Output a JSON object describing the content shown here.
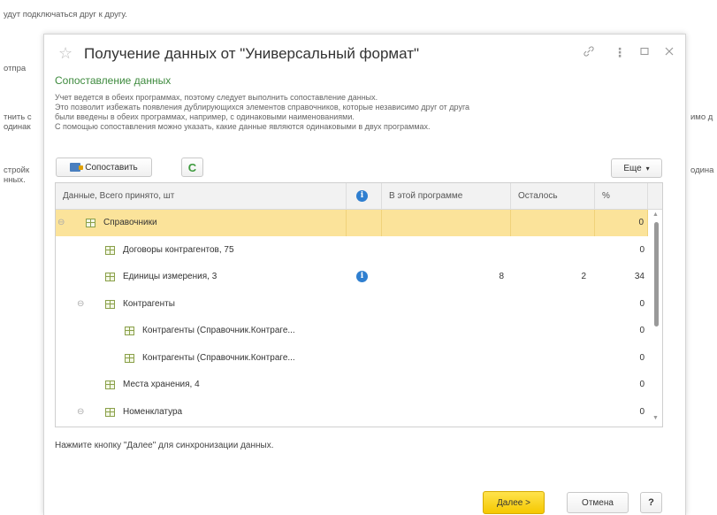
{
  "background": {
    "line1": "удут подключаться друг к другу.",
    "left_fragments": [
      "отпра",
      "тнить с",
      "одинак",
      "стройк",
      "нных."
    ],
    "right_fragments": [
      "имо д",
      "одина"
    ]
  },
  "dialog": {
    "title": "Получение данных от \"Универсальный формат\"",
    "icons": {
      "favorite": "star-icon",
      "link": "link-icon",
      "more": "more-vertical-icon",
      "maximize": "maximize-icon",
      "close": "close-icon"
    },
    "subheading": "Сопоставление данных",
    "description": [
      "Учет ведется в обеих программах, поэтому следует выполнить сопоставление данных.",
      "Это позволит избежать появления дублирующихся элементов справочников, которые независимо друг от друга",
      "были введены в обеих программах, например, с одинаковыми наименованиями.",
      "С помощью сопоставления можно указать, какие данные являются одинаковыми в двух программах."
    ],
    "toolbar": {
      "match_label": "Сопоставить",
      "refresh_icon": "refresh-icon",
      "more_label": "Еще",
      "more_arrow": "▾"
    },
    "table": {
      "columns": {
        "name": "Данные, Всего принято, шт",
        "info": "i",
        "in_program": "В этой программе",
        "remaining": "Осталось",
        "percent": "%"
      },
      "rows": [
        {
          "label": "Справочники",
          "level": 0,
          "group": true,
          "info": false,
          "in_program": "",
          "remaining": "",
          "percent": "0",
          "selected": true
        },
        {
          "label": "Договоры контрагентов, 75",
          "level": 1,
          "group": false,
          "info": false,
          "in_program": "",
          "remaining": "",
          "percent": "0",
          "selected": false
        },
        {
          "label": "Единицы измерения, 3",
          "level": 1,
          "group": false,
          "info": true,
          "in_program": "8",
          "remaining": "2",
          "percent": "34",
          "selected": false
        },
        {
          "label": "Контрагенты",
          "level": 1,
          "group": true,
          "info": false,
          "in_program": "",
          "remaining": "",
          "percent": "0",
          "selected": false
        },
        {
          "label": "Контрагенты (Справочник.Контраге...",
          "level": 2,
          "group": false,
          "info": false,
          "in_program": "",
          "remaining": "",
          "percent": "0",
          "selected": false
        },
        {
          "label": "Контрагенты (Справочник.Контраге...",
          "level": 2,
          "group": false,
          "info": false,
          "in_program": "",
          "remaining": "",
          "percent": "0",
          "selected": false
        },
        {
          "label": "Места хранения, 4",
          "level": 1,
          "group": false,
          "info": false,
          "in_program": "",
          "remaining": "",
          "percent": "0",
          "selected": false
        },
        {
          "label": "Номенклатура",
          "level": 1,
          "group": true,
          "info": false,
          "in_program": "",
          "remaining": "",
          "percent": "0",
          "selected": false
        }
      ]
    },
    "hint": "Нажмите кнопку \"Далее\" для синхронизации данных.",
    "footer": {
      "next_label": "Далее >",
      "cancel_label": "Отмена",
      "help_label": "?"
    },
    "colors": {
      "accent_green": "#3d8a3d",
      "selected_row": "#fbe39a",
      "primary_button": "#f5c800",
      "info_blue": "#2f7fd0"
    }
  }
}
